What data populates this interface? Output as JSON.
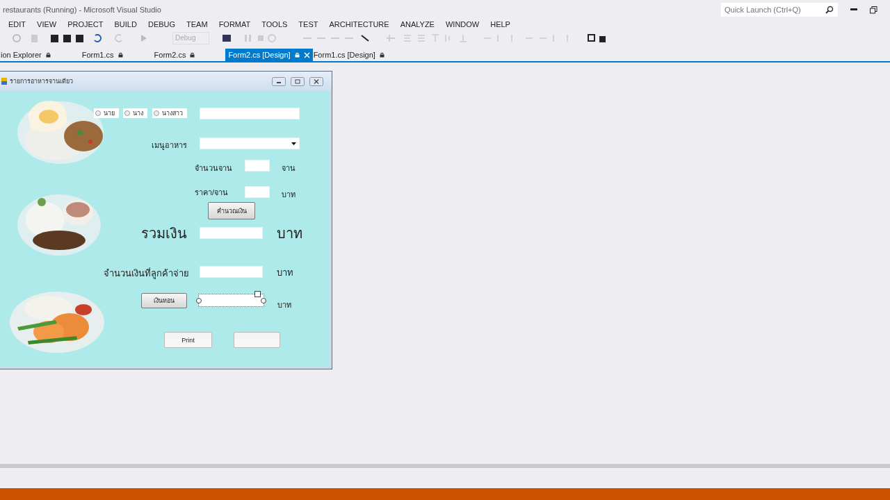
{
  "window": {
    "title": "restaurants (Running) - Microsoft Visual Studio"
  },
  "quick_launch": {
    "placeholder": "Quick Launch (Ctrl+Q)"
  },
  "menu": [
    "EDIT",
    "VIEW",
    "PROJECT",
    "BUILD",
    "DEBUG",
    "TEAM",
    "FORMAT",
    "TOOLS",
    "TEST",
    "ARCHITECTURE",
    "ANALYZE",
    "WINDOW",
    "HELP"
  ],
  "toolbar": {
    "configuration": "Debug"
  },
  "tabs": [
    {
      "label": "ion Explorer",
      "selected": false
    },
    {
      "label": "Form1.cs",
      "selected": false
    },
    {
      "label": "Form2.cs",
      "selected": false
    },
    {
      "label": "Form2.cs [Design]",
      "selected": true
    },
    {
      "label": "Form1.cs [Design]",
      "selected": false
    }
  ],
  "form": {
    "title": "รายการอาหารจานเดียว",
    "radios": [
      {
        "label": "นาย",
        "selected": false
      },
      {
        "label": "นาง",
        "selected": false
      },
      {
        "label": "นางสาว",
        "selected": false
      }
    ],
    "menu_label": "เมนูอาหาร",
    "qty_label": "จำนวนจาน",
    "qty_unit": "จาน",
    "price_label": "ราคา/จาน",
    "price_unit": "บาท",
    "calc_button": "คำนวณเงิน",
    "total_label": "รวมเงิน",
    "total_unit": "บาท",
    "paid_label": "จำนวนเงินที่ลูกค้าจ่าย",
    "paid_unit": "บาท",
    "change_button": "เงินทอน",
    "change_unit": "บาท",
    "print_button": "Print"
  }
}
